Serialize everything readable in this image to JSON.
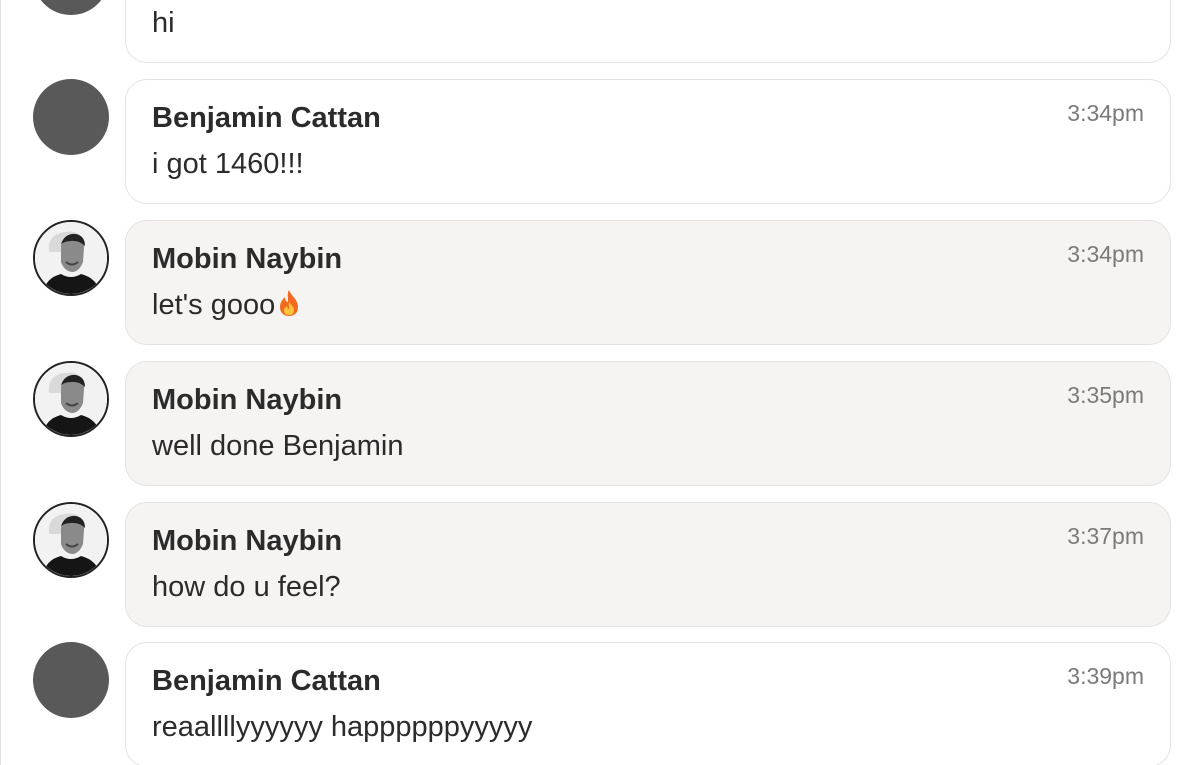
{
  "messages": [
    {
      "sender": "",
      "text": "hi",
      "time": "",
      "avatar": "grey-avatar",
      "style": "plain"
    },
    {
      "sender": "Benjamin Cattan",
      "text": "i got 1460!!!",
      "time": "3:34pm",
      "avatar": "grey-avatar",
      "style": "plain"
    },
    {
      "sender": "Mobin Naybin",
      "text": "let's gooo",
      "emoji": "fire-icon",
      "time": "3:34pm",
      "avatar": "profile-photo",
      "style": "shaded"
    },
    {
      "sender": "Mobin Naybin",
      "text": "well done Benjamin",
      "time": "3:35pm",
      "avatar": "profile-photo",
      "style": "shaded"
    },
    {
      "sender": "Mobin Naybin",
      "text": "how do u feel?",
      "time": "3:37pm",
      "avatar": "profile-photo",
      "style": "shaded"
    },
    {
      "sender": "Benjamin Cattan",
      "text": "reaallllyyyyyy happppppyyyyy",
      "time": "3:39pm",
      "avatar": "grey-avatar",
      "style": "plain"
    }
  ],
  "colors": {
    "avatar_grey": "#595959",
    "bubble_border": "#e3e3e3",
    "shaded_bubble": "#f5f4f3",
    "text": "#2b2b2b",
    "time": "#7a7a7a"
  }
}
